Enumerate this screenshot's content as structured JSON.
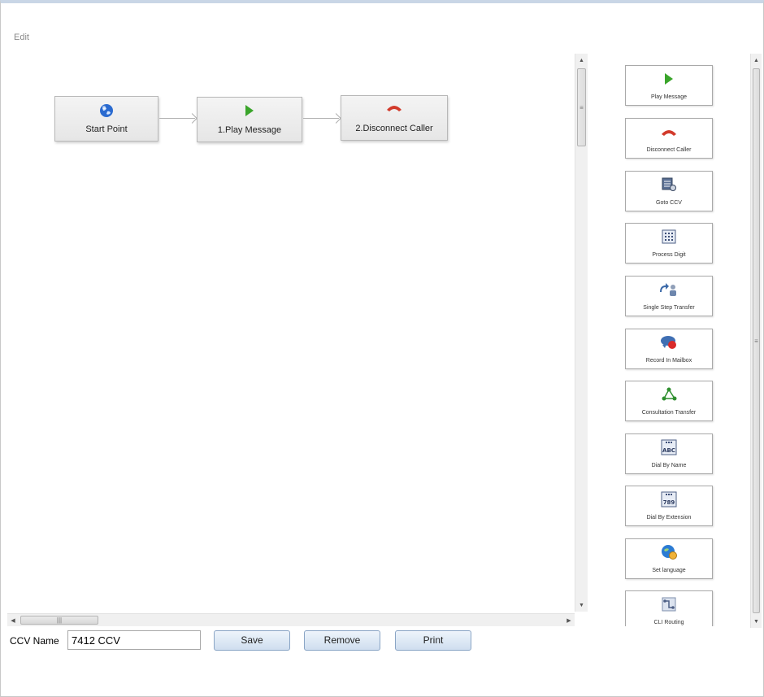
{
  "header": {
    "title": "Edit"
  },
  "flow": {
    "nodes": [
      {
        "label": "Start Point",
        "icon": "globe-icon"
      },
      {
        "label": "1.Play Message",
        "icon": "play-icon"
      },
      {
        "label": "2.Disconnect Caller",
        "icon": "hangup-icon"
      }
    ]
  },
  "palette": {
    "items": [
      {
        "label": "Play Message",
        "icon": "play-icon"
      },
      {
        "label": "Disconnect Caller",
        "icon": "hangup-icon"
      },
      {
        "label": "Goto CCV",
        "icon": "goto-ccv-icon"
      },
      {
        "label": "Process Digit",
        "icon": "keypad-icon"
      },
      {
        "label": "Single Step Transfer",
        "icon": "transfer-icon"
      },
      {
        "label": "Record In Mailbox",
        "icon": "record-icon"
      },
      {
        "label": "Consultation Transfer",
        "icon": "consult-transfer-icon"
      },
      {
        "label": "Dial By Name",
        "icon": "dial-by-name-icon"
      },
      {
        "label": "Dial By Extension",
        "icon": "dial-by-extension-icon"
      },
      {
        "label": "Set language",
        "icon": "language-icon"
      },
      {
        "label": "CLI Routing",
        "icon": "cli-routing-icon"
      }
    ]
  },
  "form": {
    "ccv_name_label": "CCV Name",
    "ccv_name_value": "7412 CCV",
    "save_label": "Save",
    "remove_label": "Remove",
    "print_label": "Print"
  },
  "colors": {
    "play": "#3aa52b",
    "hangup": "#d23a2b",
    "globe": "#2b6bd0",
    "button_border": "#8aa5c5"
  }
}
